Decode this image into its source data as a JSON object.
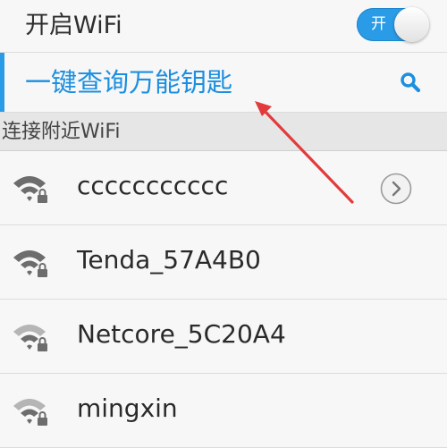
{
  "wifi_toggle": {
    "label": "开启WiFi",
    "switch_text": "开",
    "state": "on"
  },
  "key_query": {
    "label": "一键查询万能钥匙",
    "icon": "search-icon"
  },
  "section": {
    "title": "连接附近WiFi"
  },
  "networks": [
    {
      "name": "ccccccccccc",
      "icon": "wifi-locked-icon",
      "has_detail": true
    },
    {
      "name": "Tenda_57A4B0",
      "icon": "wifi-locked-icon"
    },
    {
      "name": "Netcore_5C20A4",
      "icon": "wifi-locked-icon"
    },
    {
      "name": "mingxin",
      "icon": "wifi-locked-icon"
    }
  ],
  "colors": {
    "accent": "#2a9be6",
    "accent_text": "#1b8fe0",
    "annotation_arrow": "#e23b3b"
  }
}
